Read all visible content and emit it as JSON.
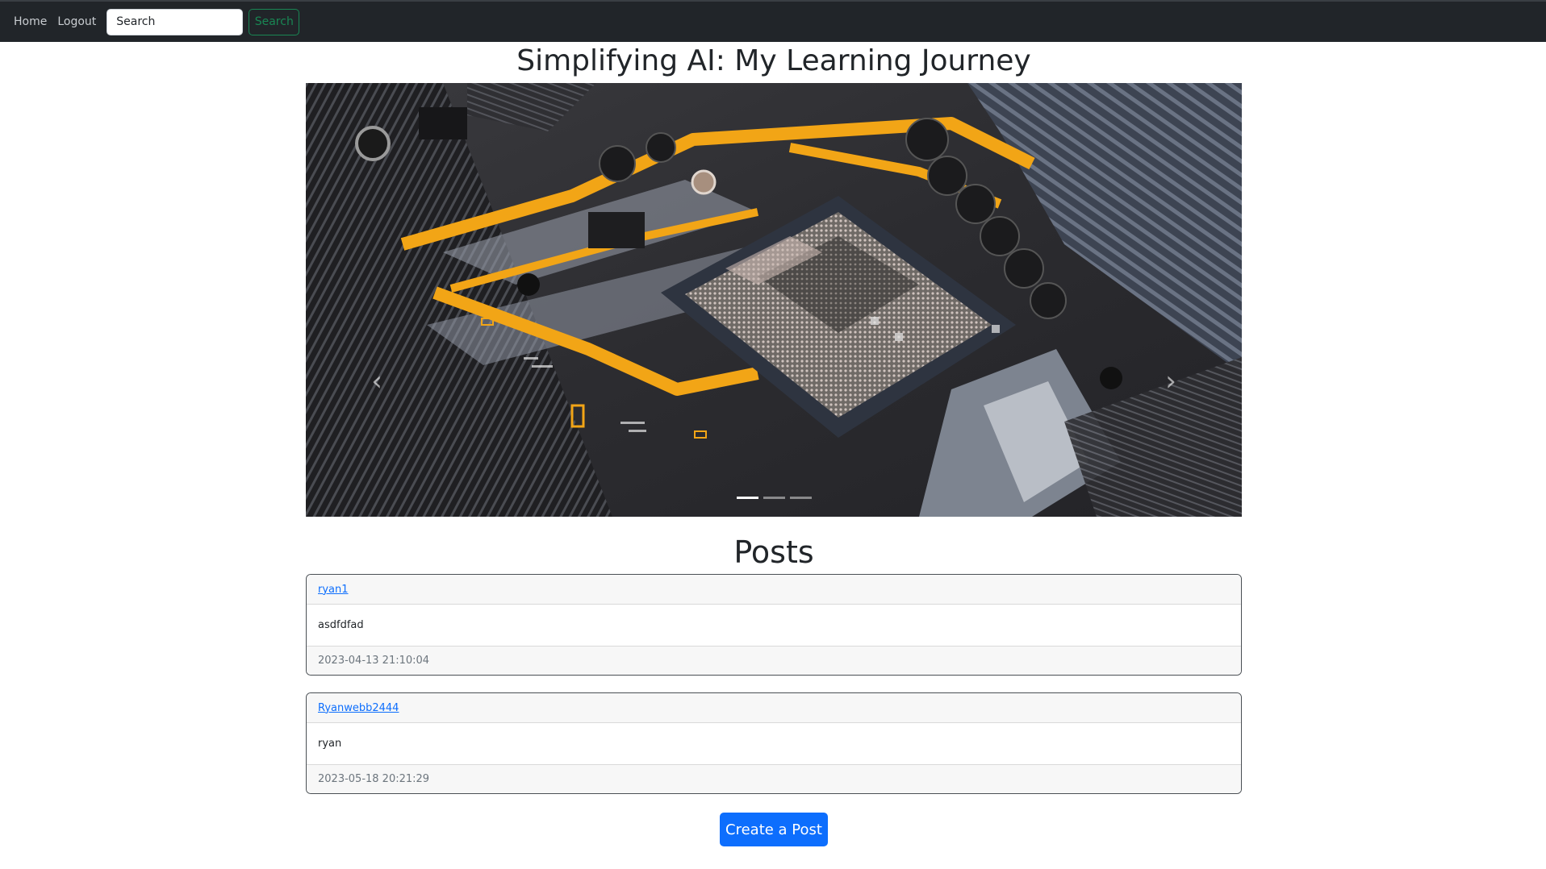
{
  "navbar": {
    "home_label": "Home",
    "logout_label": "Logout",
    "search_placeholder": "Search",
    "search_button_label": "Search"
  },
  "page": {
    "title": "Simplifying AI: My Learning Journey",
    "posts_heading": "Posts"
  },
  "carousel": {
    "image_icon": "motherboard-cpu-socket-photo",
    "prev_icon": "chevron-left-icon",
    "next_icon": "chevron-right-icon",
    "slide_count": 3,
    "active_slide": 1
  },
  "posts": [
    {
      "author": "ryan1",
      "content": "asdfdfad",
      "timestamp": "2023-04-13 21:10:04"
    },
    {
      "author": "Ryanwebb2444",
      "content": "ryan",
      "timestamp": "2023-05-18 20:21:29"
    }
  ],
  "actions": {
    "create_post_label": "Create a Post"
  },
  "colors": {
    "navbar_bg": "#212529",
    "primary": "#0d6efd",
    "success": "#198754",
    "accent_yellow": "#f2a516"
  }
}
